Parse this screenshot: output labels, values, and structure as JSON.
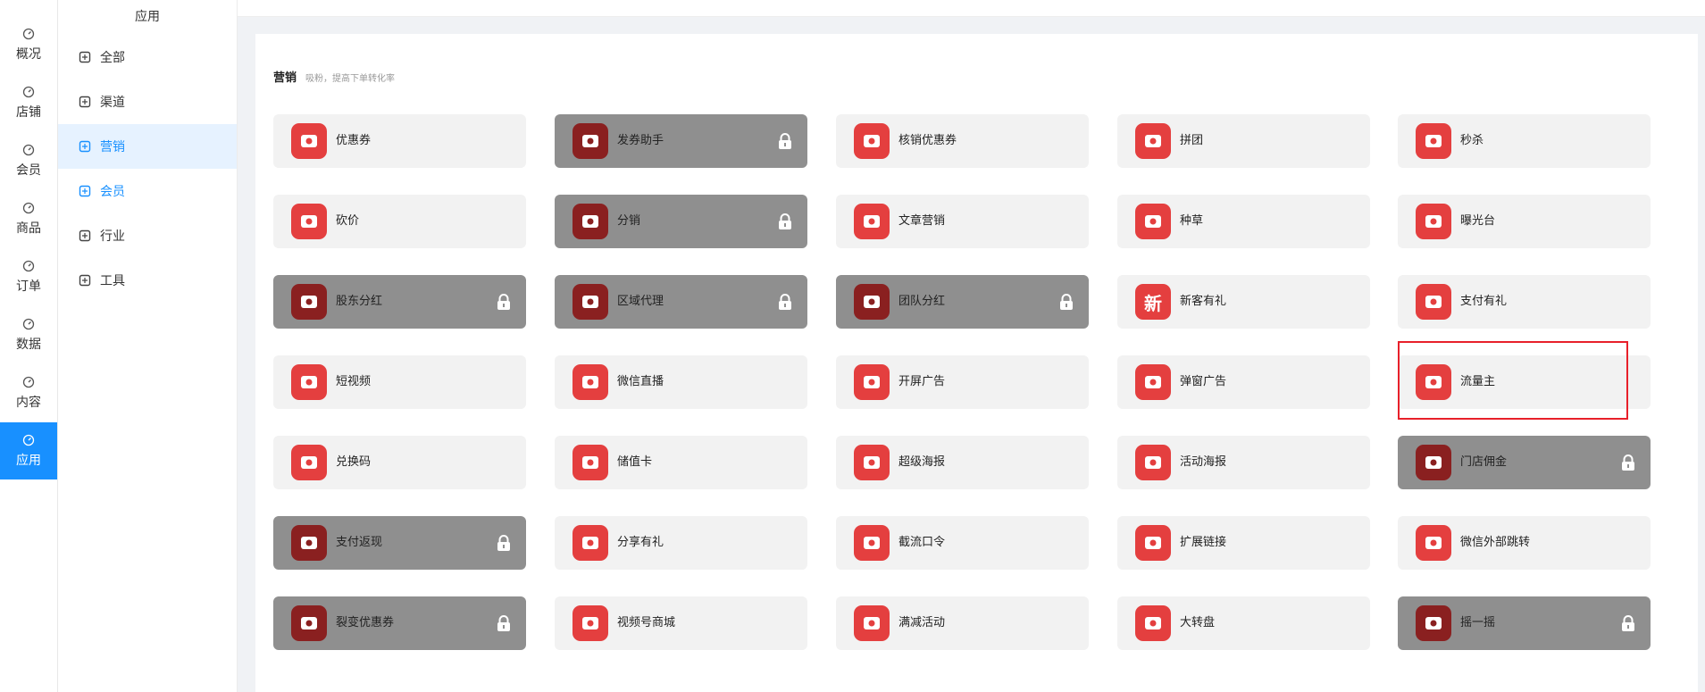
{
  "rail": {
    "items": [
      {
        "label": "概况",
        "icon": "gauge-icon"
      },
      {
        "label": "店铺",
        "icon": "store-icon"
      },
      {
        "label": "会员",
        "icon": "user-icon"
      },
      {
        "label": "商品",
        "icon": "box-icon"
      },
      {
        "label": "订单",
        "icon": "clipboard-icon"
      },
      {
        "label": "数据",
        "icon": "pie-chart-icon"
      },
      {
        "label": "内容",
        "icon": "folder-icon"
      },
      {
        "label": "应用",
        "icon": "cube-icon",
        "active": true
      }
    ]
  },
  "subnav": {
    "title": "应用",
    "items": [
      {
        "label": "全部",
        "icon": "cube-icon"
      },
      {
        "label": "渠道",
        "icon": "channel-icon"
      },
      {
        "label": "营销",
        "icon": "trend-icon",
        "active": true
      },
      {
        "label": "会员",
        "icon": "user-icon"
      },
      {
        "label": "行业",
        "icon": "briefcase-icon"
      },
      {
        "label": "工具",
        "icon": "wrench-icon"
      }
    ]
  },
  "section": {
    "title": "营销",
    "subtitle": "吸粉，提高下单转化率"
  },
  "colors": {
    "accent": "#1890ff",
    "tile_icon": "#e43f3f",
    "locked_tile": "#8f8f8f",
    "selection": "#e8202a"
  },
  "tiles": [
    {
      "label": "优惠券",
      "locked": false,
      "icon": "coupon-icon"
    },
    {
      "label": "发券助手",
      "locked": true,
      "icon": "ticket-icon"
    },
    {
      "label": "核销优惠券",
      "locked": false,
      "icon": "verify-coupon-icon"
    },
    {
      "label": "拼团",
      "locked": false,
      "icon": "bag-icon"
    },
    {
      "label": "秒杀",
      "locked": false,
      "icon": "lightning-icon"
    },
    {
      "label": "砍价",
      "locked": false,
      "icon": "tag-icon"
    },
    {
      "label": "分销",
      "locked": true,
      "icon": "money-bag-icon"
    },
    {
      "label": "文章营销",
      "locked": false,
      "icon": "article-icon"
    },
    {
      "label": "种草",
      "locked": false,
      "icon": "sprout-icon"
    },
    {
      "label": "曝光台",
      "locked": false,
      "icon": "sun-icon"
    },
    {
      "label": "股东分红",
      "locked": true,
      "icon": "hand-coins-icon"
    },
    {
      "label": "区域代理",
      "locked": true,
      "icon": "coins-icon"
    },
    {
      "label": "团队分红",
      "locked": true,
      "icon": "pie-icon"
    },
    {
      "label": "新客有礼",
      "locked": false,
      "icon": "new-badge-icon",
      "glyph": "新"
    },
    {
      "label": "支付有礼",
      "locked": false,
      "icon": "gift-icon"
    },
    {
      "label": "短视频",
      "locked": false,
      "icon": "video-icon"
    },
    {
      "label": "微信直播",
      "locked": false,
      "icon": "live-icon"
    },
    {
      "label": "开屏广告",
      "locked": false,
      "icon": "ad-screen-icon"
    },
    {
      "label": "弹窗广告",
      "locked": false,
      "icon": "ad-popup-icon"
    },
    {
      "label": "流量主",
      "locked": false,
      "icon": "traffic-icon",
      "selected": true
    },
    {
      "label": "兑换码",
      "locked": false,
      "icon": "redeem-code-icon"
    },
    {
      "label": "储值卡",
      "locked": false,
      "icon": "card-icon"
    },
    {
      "label": "超级海报",
      "locked": false,
      "icon": "star-icon"
    },
    {
      "label": "活动海报",
      "locked": false,
      "icon": "timer-icon"
    },
    {
      "label": "门店佣金",
      "locked": true,
      "icon": "store-commission-icon"
    },
    {
      "label": "支付返现",
      "locked": true,
      "icon": "cashback-icon"
    },
    {
      "label": "分享有礼",
      "locked": false,
      "icon": "share-gift-icon"
    },
    {
      "label": "截流口令",
      "locked": false,
      "icon": "password-icon"
    },
    {
      "label": "扩展链接",
      "locked": false,
      "icon": "link-icon"
    },
    {
      "label": "微信外部跳转",
      "locked": false,
      "icon": "wechat-icon"
    },
    {
      "label": "裂变优惠券",
      "locked": true,
      "icon": "fission-coupon-icon"
    },
    {
      "label": "视频号商城",
      "locked": false,
      "icon": "video-shop-icon"
    },
    {
      "label": "满减活动",
      "locked": false,
      "icon": "discount-icon"
    },
    {
      "label": "大转盘",
      "locked": false,
      "icon": "wheel-icon"
    },
    {
      "label": "摇一摇",
      "locked": true,
      "icon": "shake-icon"
    }
  ]
}
